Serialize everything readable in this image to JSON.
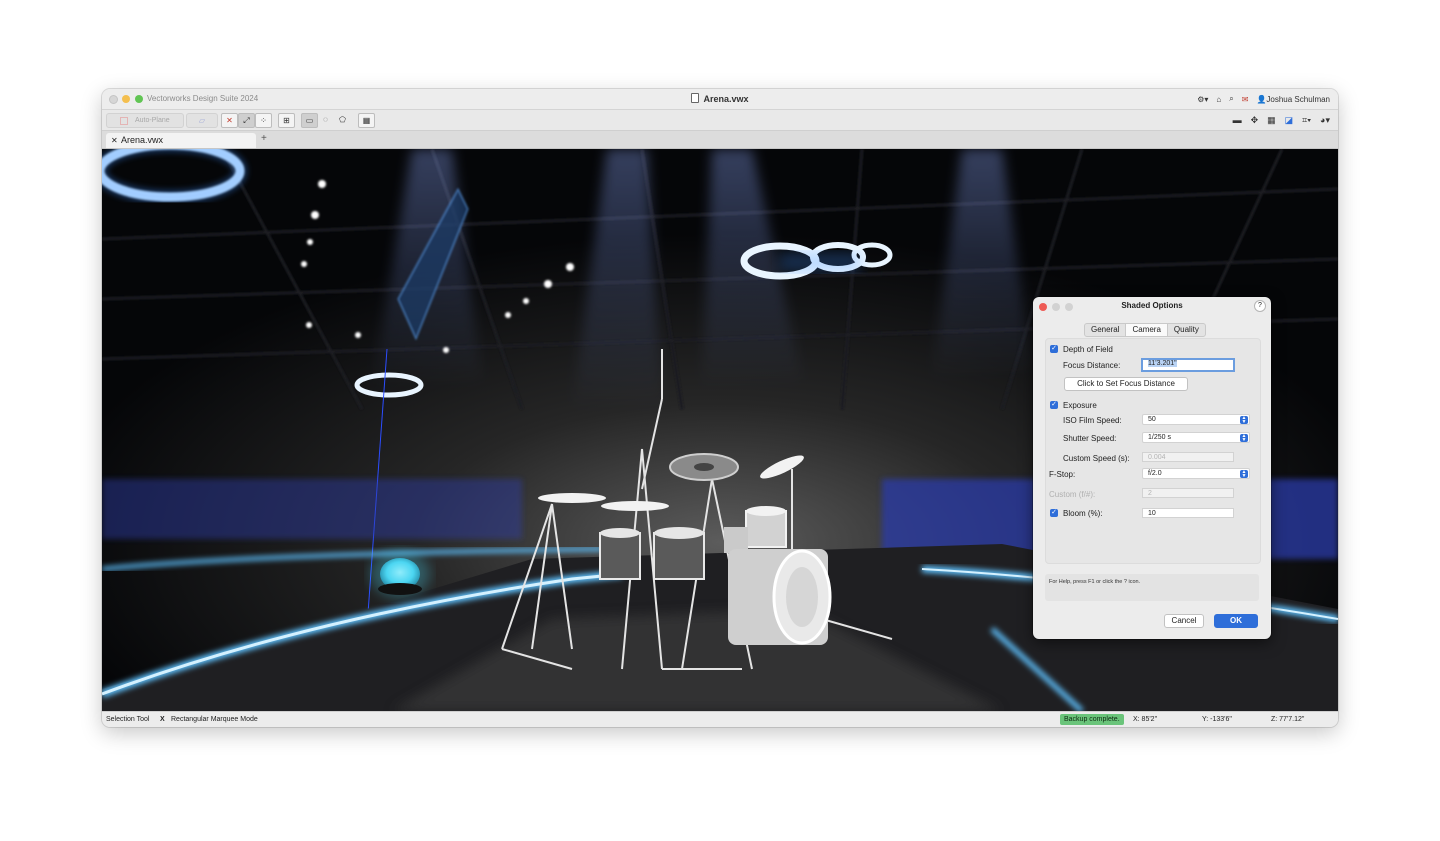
{
  "window": {
    "app_name": "Vectorworks Design Suite 2024",
    "doc_title": "Arena.vwx",
    "user": "Joshua Schulman"
  },
  "toolbar": {
    "auto_plane": "Auto-Plane"
  },
  "tabs": [
    {
      "label": "Arena.vwx"
    }
  ],
  "dialog": {
    "title": "Shaded Options",
    "help": "?",
    "tabs": [
      "General",
      "Camera",
      "Quality"
    ],
    "selected_tab": "Camera",
    "depth_of_field": {
      "label": "Depth of Field",
      "checked": true
    },
    "focus_distance": {
      "label": "Focus Distance:",
      "value": "11'3.201\""
    },
    "set_focus_button": "Click to Set Focus Distance",
    "exposure": {
      "label": "Exposure",
      "checked": true
    },
    "iso": {
      "label": "ISO Film Speed:",
      "value": "50"
    },
    "shutter": {
      "label": "Shutter Speed:",
      "value": "1/250 s"
    },
    "custom_speed": {
      "label": "Custom Speed (s):",
      "value": "0.004"
    },
    "fstop": {
      "label": "F-Stop:",
      "value": "f/2.0"
    },
    "custom_f": {
      "label": "Custom (f/#):",
      "value": "2"
    },
    "bloom": {
      "label": "Bloom (%):",
      "value": "10",
      "checked": true
    },
    "help_text": "For Help, press F1 or click the ? icon.",
    "cancel": "Cancel",
    "ok": "OK"
  },
  "status": {
    "tool": "Selection Tool",
    "separator": "X",
    "mode": "Rectangular Marquee Mode",
    "backup": "Backup complete.",
    "x": "X: 85'2\"",
    "y": "Y: -133'6\"",
    "z": "Z: 77'7.12\""
  },
  "colors": {
    "accent": "#2e6ed9",
    "backup_badge": "#6ac47a",
    "stage_glow": "#3aa3ff"
  }
}
